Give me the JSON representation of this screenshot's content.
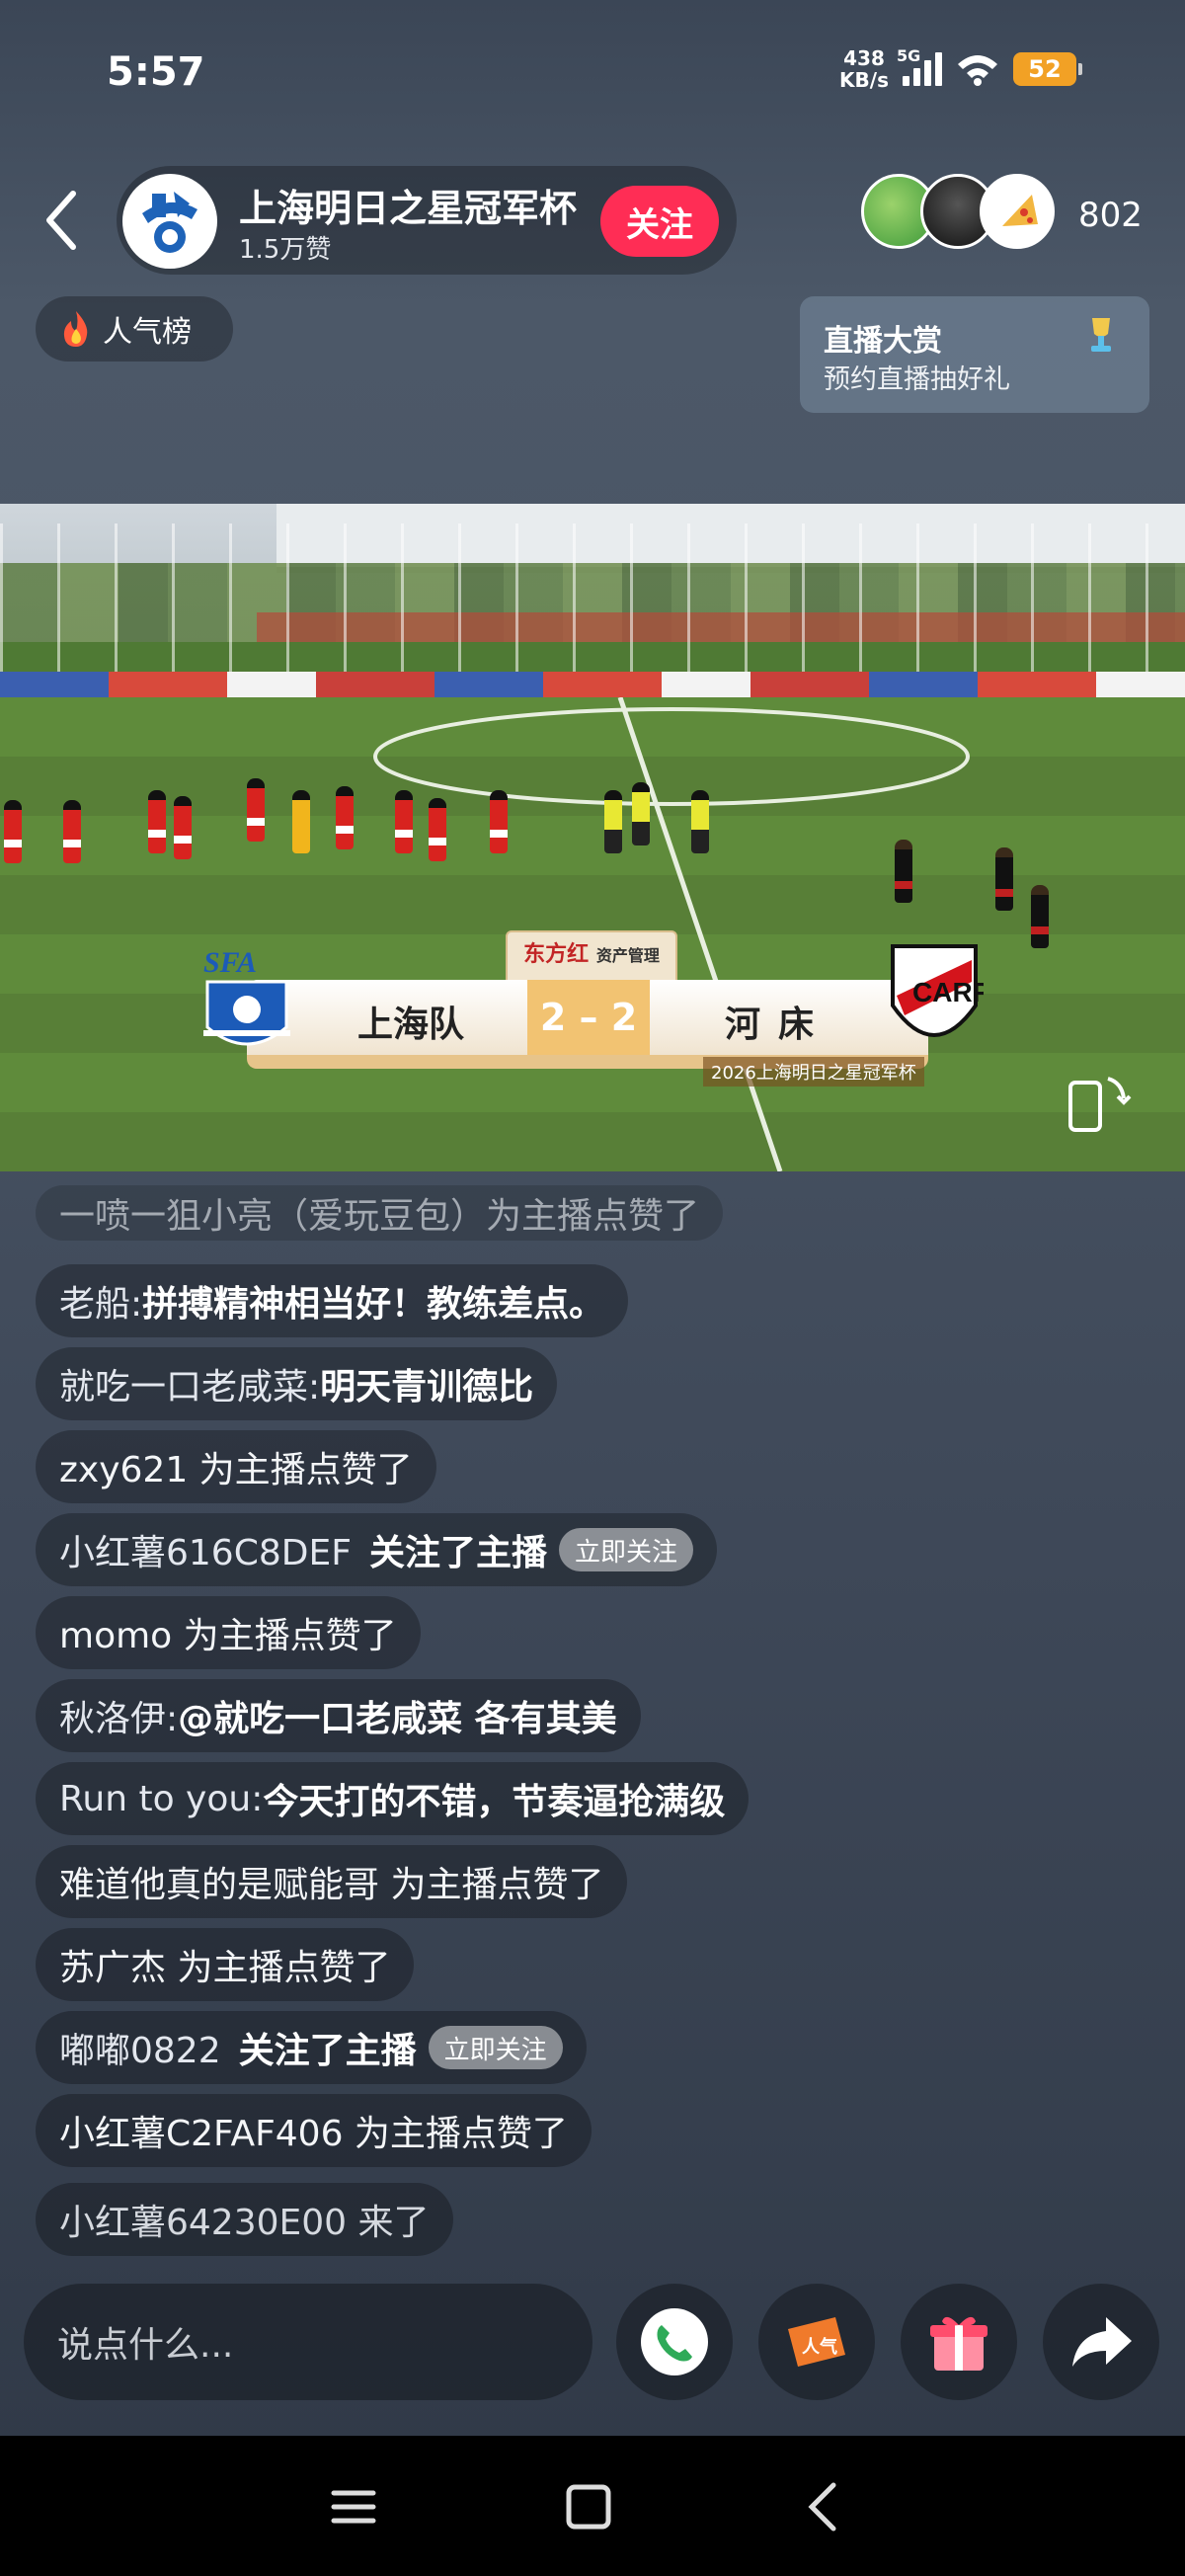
{
  "status": {
    "time": "5:57",
    "net_speed": "438",
    "net_unit": "KB/s",
    "network": "5G",
    "battery": "52"
  },
  "host": {
    "name": "上海明日之星冠军杯",
    "likes": "1.5万赞",
    "follow_label": "关注"
  },
  "viewers": {
    "count": "802"
  },
  "popularity": {
    "label": "人气榜"
  },
  "award": {
    "title": "直播大赏",
    "subtitle": "预约直播抽好礼"
  },
  "match": {
    "home_badge": "SFA",
    "home_team": "上海队",
    "score": "2 – 2",
    "away_team": "河床",
    "sponsor": "东方红",
    "sponsor_sub": "资产管理",
    "tournament": "2026上海明日之星冠军杯"
  },
  "comments": [
    {
      "system": "一喷一狙小亮（爱玩豆包）为主播点赞了"
    },
    {
      "user": "老船: ",
      "text": "拼搏精神相当好！教练差点。"
    },
    {
      "user": "就吃一口老咸菜: ",
      "text": "明天青训德比"
    },
    {
      "system": "zxy621 为主播点赞了"
    },
    {
      "user": "小红薯616C8DEF",
      "text": "关注了主播",
      "chip": "立即关注"
    },
    {
      "system": "momo 为主播点赞了"
    },
    {
      "user": "秋洛伊: ",
      "text": "@就吃一口老咸菜 各有其美"
    },
    {
      "user": "Run to you: ",
      "text": "今天打的不错，节奏逼抢满级"
    },
    {
      "system": "难道他真的是赋能哥 为主播点赞了"
    },
    {
      "system": "苏广杰 为主播点赞了"
    },
    {
      "user": "嘟嘟0822",
      "text": "关注了主播",
      "chip": "立即关注"
    },
    {
      "system": "小红薯C2FAF406 为主播点赞了"
    },
    {
      "system": "小红薯64230E00 来了"
    }
  ],
  "input": {
    "placeholder": "说点什么..."
  },
  "actions": {
    "popularity_label": "人气"
  },
  "colors": {
    "accent": "#ff2d55",
    "battery": "#f2a125",
    "score_box": "#f2c372"
  }
}
